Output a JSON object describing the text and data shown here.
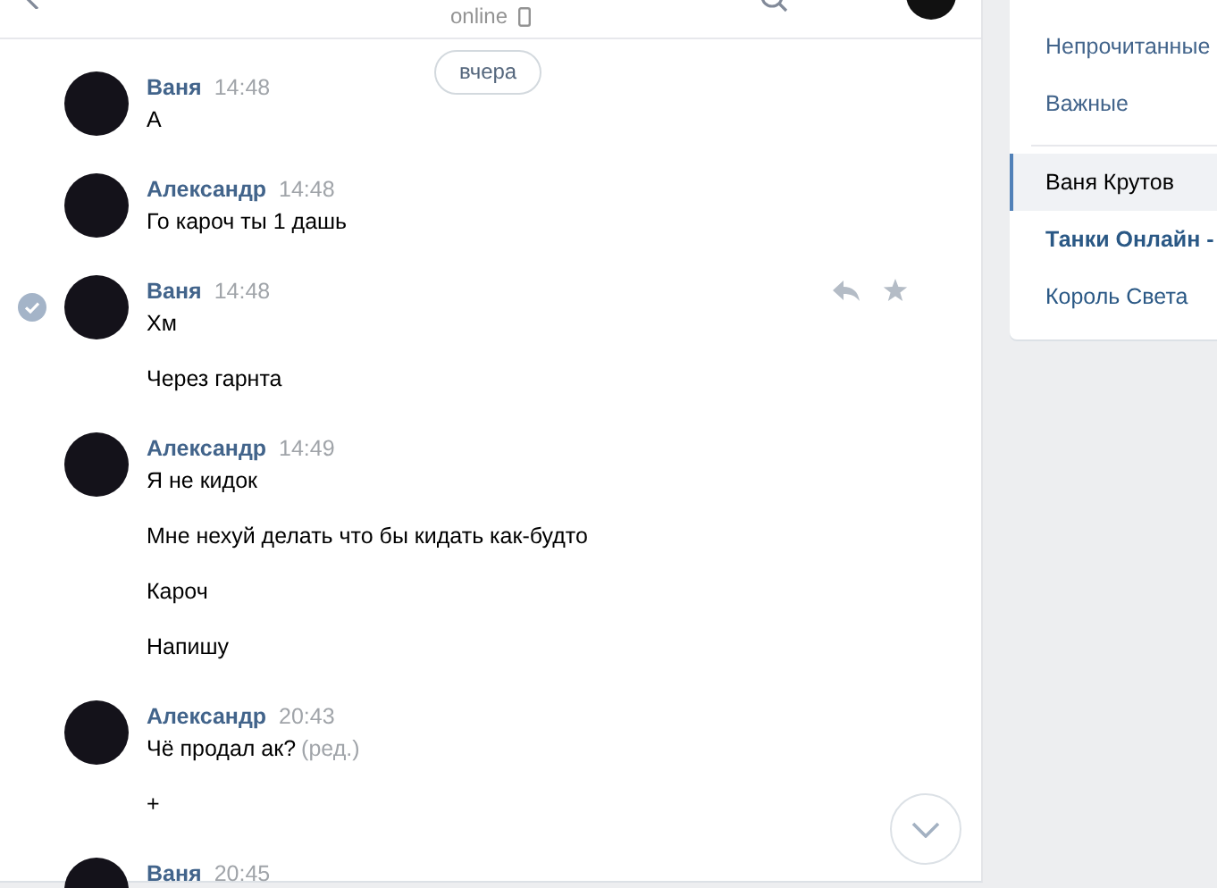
{
  "header": {
    "status": "online"
  },
  "date_pill": "вчера",
  "messages": [
    {
      "author": "Ваня",
      "time": "14:48",
      "selected": false,
      "lines": [
        {
          "text": "А"
        }
      ]
    },
    {
      "author": "Александр",
      "time": "14:48",
      "selected": false,
      "lines": [
        {
          "text": "Го кароч ты 1 дашь"
        }
      ]
    },
    {
      "author": "Ваня",
      "time": "14:48",
      "selected": true,
      "lines": [
        {
          "text": "Хм"
        },
        {
          "text": "Через гарнта"
        }
      ]
    },
    {
      "author": "Александр",
      "time": "14:49",
      "selected": false,
      "lines": [
        {
          "text": "Я не кидок"
        },
        {
          "text": "Мне нехуй делать что бы кидать как-будто"
        },
        {
          "text": "Кароч"
        },
        {
          "text": "Напишу"
        }
      ]
    },
    {
      "author": "Александр",
      "time": "20:43",
      "selected": false,
      "lines": [
        {
          "text": "Чё продал ак?",
          "edited": "(ред.)"
        },
        {
          "text": "+"
        }
      ]
    },
    {
      "author": "Ваня",
      "time": "20:45",
      "selected": false
    }
  ],
  "sidebar": {
    "filters": [
      "Непрочитанные",
      "Важные"
    ],
    "chats": [
      {
        "label": "Ваня Крутов",
        "selected": true,
        "unread": false
      },
      {
        "label": "Танки Онлайн -",
        "selected": false,
        "unread": true
      },
      {
        "label": "Король Света",
        "selected": false,
        "unread": false
      }
    ]
  }
}
